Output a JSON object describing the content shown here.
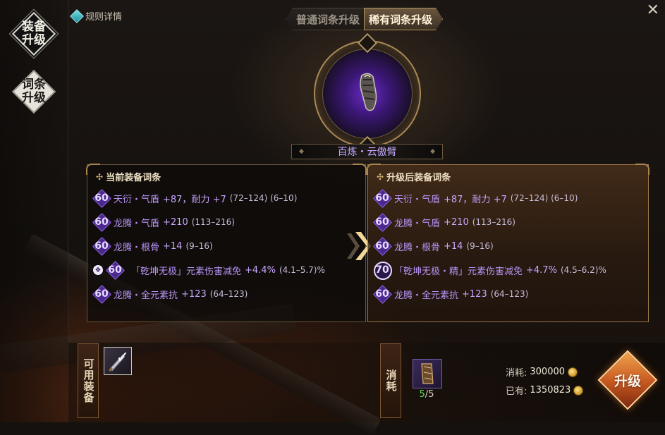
{
  "nav": {
    "equip_upgrade": "装备\n升级",
    "affix_upgrade": "词条\n升级"
  },
  "rules": {
    "label": "规则详情"
  },
  "close": {
    "label": "✕"
  },
  "tabs": [
    {
      "label": "普通词条升级",
      "active": false
    },
    {
      "label": "稀有词条升级",
      "active": true
    }
  ],
  "item": {
    "name": "百炼・云傲臂",
    "icon": "arm-guard-icon"
  },
  "current_panel": {
    "title": "当前装备词条",
    "affixes": [
      {
        "level": "60",
        "name": "天衍・气盾",
        "value": "+87，耐力 +7",
        "range": "(72–124) (6–10)",
        "locked": false
      },
      {
        "level": "60",
        "name": "龙腾・气盾",
        "value": "+210",
        "range": "(113–216)",
        "locked": false
      },
      {
        "level": "60",
        "name": "龙腾・根骨",
        "value": "+14",
        "range": "(9–16)",
        "locked": false
      },
      {
        "level": "60",
        "name": "「乾坤无极」元素伤害减免",
        "value": "+4.4%",
        "range": "(4.1–5.7)%",
        "locked": true
      },
      {
        "level": "60",
        "name": "龙腾・全元素抗",
        "value": "+123",
        "range": "(64–123)",
        "locked": false
      }
    ]
  },
  "upgraded_panel": {
    "title": "升级后装备词条",
    "affixes": [
      {
        "level": "60",
        "name": "天衍・气盾",
        "value": "+87，耐力 +7",
        "range": "(72–124) (6–10)",
        "round": false
      },
      {
        "level": "60",
        "name": "龙腾・气盾",
        "value": "+210",
        "range": "(113–216)",
        "round": false
      },
      {
        "level": "60",
        "name": "龙腾・根骨",
        "value": "+14",
        "range": "(9–16)",
        "round": false
      },
      {
        "level": "70",
        "name": "「乾坤无极・精」元素伤害减免",
        "value": "+4.7%",
        "range": "(4.5–6.2)%",
        "round": true
      },
      {
        "level": "60",
        "name": "龙腾・全元素抗",
        "value": "+123",
        "range": "(64–123)",
        "round": false
      }
    ]
  },
  "available": {
    "label": "可用装备"
  },
  "consume": {
    "label": "消耗",
    "item_have": "5",
    "item_need": "5",
    "cost_label": "消耗:",
    "cost_value": "300000",
    "own_label": "已有:",
    "own_value": "1350823"
  },
  "upgrade_button": {
    "label": "升级"
  },
  "colors": {
    "affix_purple": "#b893f5",
    "accent_gold": "#a88a55",
    "count_green": "#56e05c",
    "button_orange": "#c4561f"
  }
}
